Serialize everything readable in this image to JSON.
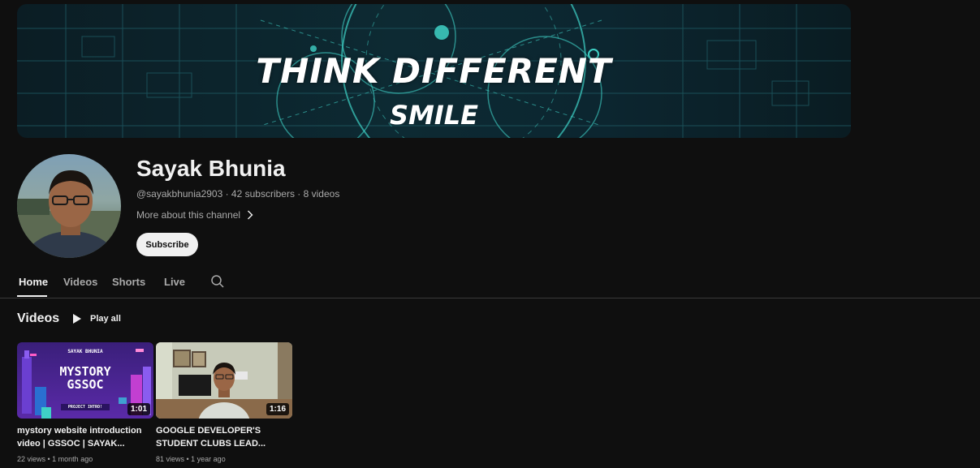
{
  "banner": {
    "title": "THINK DIFFERENT",
    "subtitle": "SMILE"
  },
  "channel": {
    "name": "Sayak Bhunia",
    "meta": "@sayakbhunia2903 · 42 subscribers · 8 videos",
    "more": "More about this channel",
    "subscribe": "Subscribe"
  },
  "tabs": [
    "Home",
    "Videos",
    "Shorts",
    "Live"
  ],
  "section": {
    "title": "Videos",
    "play_all": "Play all"
  },
  "videos": [
    {
      "thumb_title": "MYSTORY GSSOC",
      "thumb_top": "SAYAK BHUNIA",
      "thumb_bottom": "PROJECT INTRO!",
      "duration": "1:01",
      "title": "mystory website introduction video | GSSOC | SAYAK...",
      "meta": "22 views • 1 month ago"
    },
    {
      "duration": "1:16",
      "title": "GOOGLE DEVELOPER'S STUDENT CLUBS LEAD...",
      "meta": "81 views • 1 year ago"
    }
  ],
  "colors": {
    "accent": "#3fd1c6",
    "background": "#0f0f0f"
  }
}
